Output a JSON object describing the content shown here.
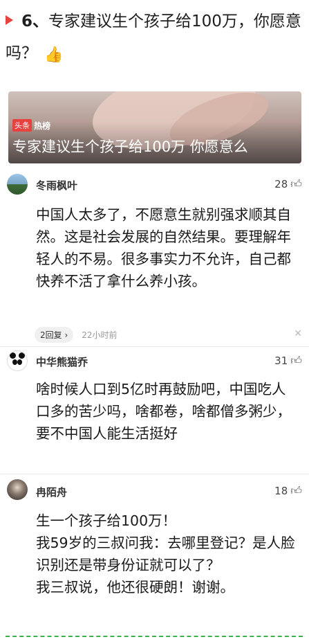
{
  "headline": {
    "number": "6、",
    "text": "专家建议生个孩子给100万，你愿意吗？",
    "emoji": "👍"
  },
  "banner": {
    "tag_label": "头条",
    "hot_label": "热榜",
    "title": "专家建议生个孩子给100万 你愿意么"
  },
  "comments": [
    {
      "username": "冬雨枫叶",
      "likes": "28",
      "text": "中国人太多了，不愿意生就别强求顺其自然。这是社会发展的自然结果。要理解年轻人的不易。很多事实力不允许，自己都快养不活了拿什么养小孩。",
      "reply_label": "2回复 ›",
      "time": "22小时前"
    },
    {
      "username": "中华熊猫乔",
      "likes": "31",
      "text": "啥时候人口到5亿时再鼓励吧，中国吃人口多的苦少吗，啥都卷，啥都僧多粥少，要不中国人能生活挺好"
    },
    {
      "username": "冉陌舟",
      "likes": "18",
      "text_lines": [
        "生一个孩子给100万！",
        "我59岁的三叔问我：去哪里登记？是人脸识别还是带身份证就可以了？",
        "我三叔说，他还很硬朗！谢谢。"
      ]
    }
  ],
  "icons": {
    "like": "thumbs-up-outline-icon",
    "close": "close-icon",
    "headline_marker": "red-triangle-icon"
  },
  "colors": {
    "accent_red": "#e8423f",
    "dash_green": "#3cb34a"
  }
}
